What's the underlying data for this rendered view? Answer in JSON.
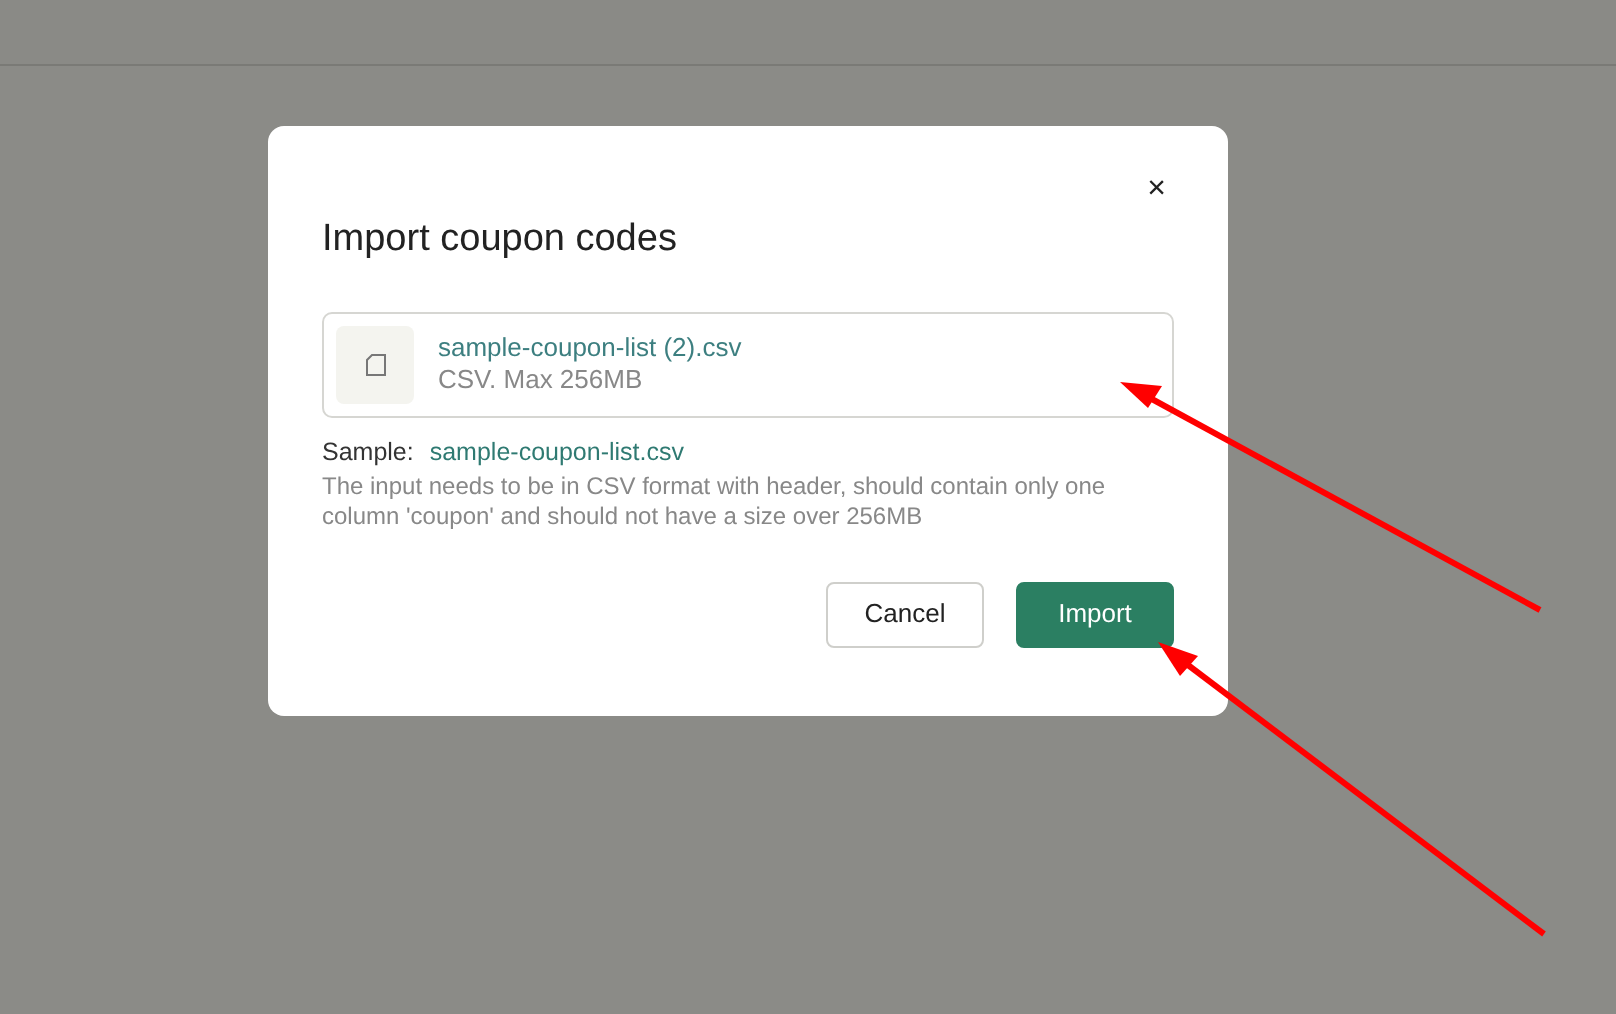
{
  "dialog": {
    "title": "Import coupon codes",
    "close": "×",
    "file": {
      "name": "sample-coupon-list (2).csv",
      "hint": "CSV. Max 256MB"
    },
    "sample": {
      "label": "Sample:",
      "link": "sample-coupon-list.csv"
    },
    "help": "The input needs to be in CSV format with header, should contain only one column 'coupon' and should not have a size over 256MB",
    "buttons": [
      {
        "label": "Cancel",
        "kind": "secondary"
      },
      {
        "label": "Import",
        "kind": "primary"
      }
    ]
  }
}
